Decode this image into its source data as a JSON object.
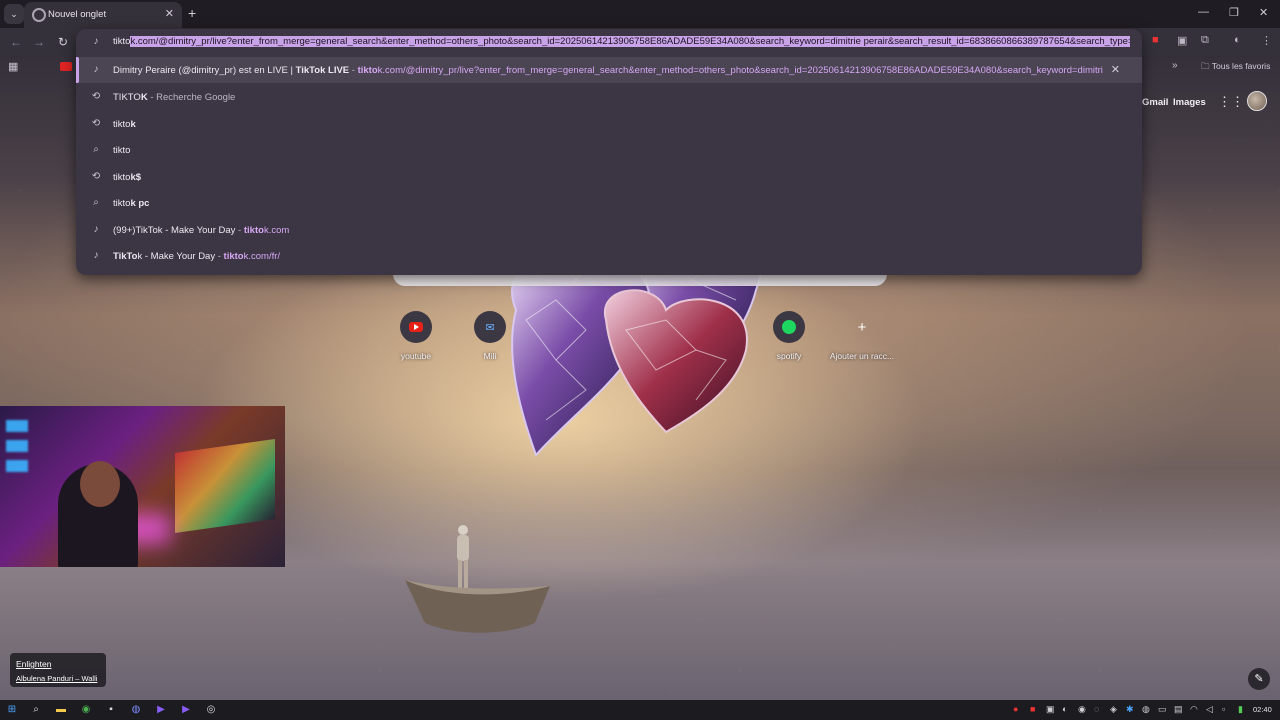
{
  "tab": {
    "title": "Nouvel onglet",
    "close": "✕",
    "new": "+"
  },
  "window": {
    "minimize": "—",
    "restore": "❐",
    "close": "✕"
  },
  "omnibox": {
    "typed": "tikto",
    "autocomplete": "k.com/@dimitry_pr/live?enter_from_merge=general_search&enter_method=others_photo&search_id=20250614213906758E86ADADE59E34A080&search_keyword=dimitrie perair&search_result_id=6838660866389787654&search_type=genera"
  },
  "suggestions": [
    {
      "icon": "tiktok-icon",
      "title_prefix": "Dimitry Peraire (@dimitry_pr) est en LIVE | ",
      "title_bold": "TikTo",
      "title_suffix": "k LIVE",
      "sep": " - ",
      "url_bold": "tikto",
      "url_rest": "k.com/@dimitry_pr/live?enter_from_merge=general_search&enter_method=others_photo&search_id=20250614213906758E86ADADE59E34A080&search_keyword=dimitrie pera...",
      "remove": "✕"
    },
    {
      "icon": "history-icon",
      "text_bold": "TIKTO",
      "text_rest": "K",
      "sub": " - Recherche Google"
    },
    {
      "icon": "history-icon",
      "text_bold": "tikto",
      "text_rest": "k"
    },
    {
      "icon": "search-icon",
      "text_bold": "tikto",
      "text_rest": ""
    },
    {
      "icon": "history-icon",
      "text_bold": "tikto",
      "text_rest": "k$"
    },
    {
      "icon": "search-icon",
      "text_bold": "tikto",
      "text_rest": "k pc"
    },
    {
      "icon": "tiktok-icon",
      "text_bold": "(99+)TikTo",
      "text_rest": "k - Make Your Day",
      "sep": " - ",
      "url_bold": "tikto",
      "url_rest": "k.com"
    },
    {
      "icon": "tiktok-icon",
      "text_bold": "TikTo",
      "text_rest": "k - Make Your Day",
      "sep": " - ",
      "url_bold": "tikto",
      "url_rest": "k.com/fr/"
    }
  ],
  "bookmarks": {
    "all": "Tous les favoris",
    "more": "»"
  },
  "google": {
    "gmail": "Gmail",
    "images": "Images"
  },
  "shortcuts": [
    {
      "label": "youtube",
      "icon": "youtube-icon"
    },
    {
      "label": "Mili",
      "icon": "mail-icon"
    },
    {
      "label": "spotify",
      "icon": "spotify-icon"
    },
    {
      "label": "Ajouter un racc...",
      "icon": "plus-icon"
    }
  ],
  "song": {
    "title": "Enlighten",
    "artist": "Albulena Panduri – Walli"
  },
  "taskbar": {
    "time": "02:40"
  },
  "colors": {
    "accent": "#c9a3e8",
    "omnibox_bg": "#3c3644",
    "tab_bg": "#35313b"
  }
}
